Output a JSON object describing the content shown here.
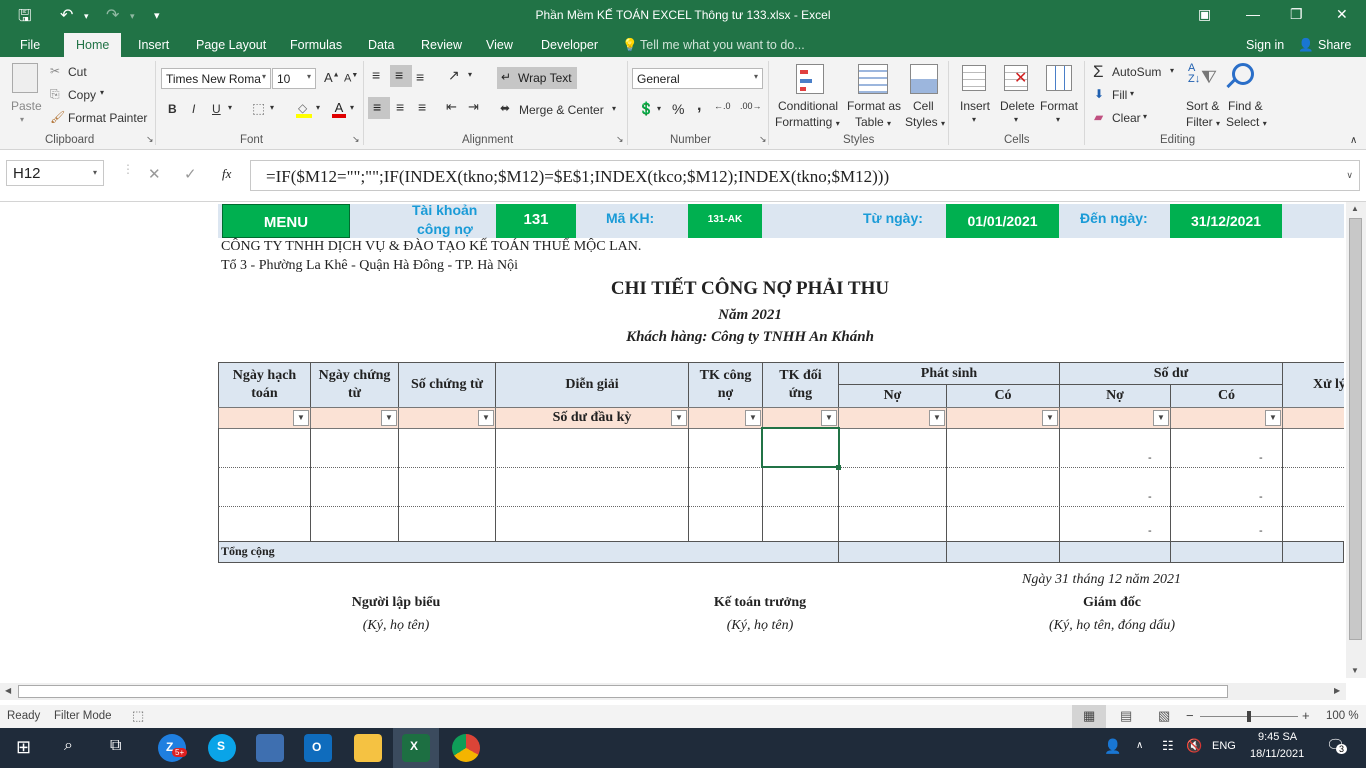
{
  "window": {
    "title": "Phần Mềm KẾ TOÁN  EXCEL Thông tư 133.xlsx - Excel"
  },
  "tabs": [
    "File",
    "Home",
    "Insert",
    "Page Layout",
    "Formulas",
    "Data",
    "Review",
    "View",
    "Developer"
  ],
  "tell_me": "Tell me what you want to do...",
  "sign_in": "Sign in",
  "share": "Share",
  "ribbon": {
    "clipboard": {
      "paste": "Paste",
      "cut": "Cut",
      "copy": "Copy",
      "format_painter": "Format Painter",
      "group": "Clipboard"
    },
    "font": {
      "name": "Times New Roma",
      "size": "10",
      "bold": "B",
      "italic": "I",
      "underline": "U",
      "group": "Font"
    },
    "alignment": {
      "wrap_text": "Wrap Text",
      "merge_center": "Merge & Center",
      "group": "Alignment"
    },
    "number": {
      "format": "General",
      "percent": "%",
      "comma": ",",
      "group": "Number"
    },
    "styles": {
      "conditional": "Conditional",
      "formatting": "Formatting",
      "format_as": "Format as",
      "table": "Table",
      "cell": "Cell",
      "styles_label": "Styles",
      "group": "Styles"
    },
    "cells": {
      "insert": "Insert",
      "delete": "Delete",
      "format": "Format",
      "group": "Cells"
    },
    "editing": {
      "autosum": "AutoSum",
      "fill": "Fill",
      "clear": "Clear",
      "sort": "Sort &",
      "filter": "Filter",
      "find": "Find &",
      "select": "Select",
      "group": "Editing"
    }
  },
  "formula_bar": {
    "name_box": "H12",
    "fx": "fx",
    "formula": "=IF($M12=\"\";\"\";IF(INDEX(tkno;$M12)=$E$1;INDEX(tkco;$M12);INDEX(tkno;$M12)))"
  },
  "sheet": {
    "menu": "MENU",
    "tai_khoan_1": "Tài khoản",
    "tai_khoan_2": "công nợ",
    "tk_value": "131",
    "ma_kh_label": "Mã KH:",
    "ma_kh_value": "131-AK",
    "tu_ngay_label": "Từ ngày:",
    "tu_ngay_value": "01/01/2021",
    "den_ngay_label": "Đến ngày:",
    "den_ngay_value": "31/12/2021",
    "company": "CÔNG TY TNHH DỊCH VỤ & ĐÀO TẠO KẾ TOÁN THUẾ MỘC LAN.",
    "address": "Tổ 3 - Phường La Khê - Quận Hà Đông - TP. Hà Nội",
    "report_title": "CHI TIẾT CÔNG NỢ PHẢI THU",
    "year": "Năm 2021",
    "customer": "Khách hàng: Công ty TNHH An Khánh",
    "headers": {
      "ngay_hach_toan": "Ngày hạch toán",
      "ngay_chung_tu": "Ngày chứng từ",
      "so_chung_tu": "Số chứng từ",
      "dien_giai": "Diễn giải",
      "tk_cong_no": "TK công nợ",
      "tk_doi_ung": "TK đối ứng",
      "phat_sinh": "Phát sinh",
      "so_du": "Số dư",
      "no": "Nợ",
      "co": "Có",
      "xu_ly": "Xử lý"
    },
    "opening_balance": "Số dư đầu kỳ",
    "dash": "-",
    "total": "Tổng cộng",
    "date_line": "Ngày 31 tháng 12 năm 2021",
    "sign1_title": "Người lập biểu",
    "sign1_sub": "(Ký, họ tên)",
    "sign2_title": "Kế toán trưởng",
    "sign2_sub": "(Ký, họ tên)",
    "sign3_title": "Giám đốc",
    "sign3_sub": "(Ký, họ tên, đóng dấu)"
  },
  "status": {
    "ready": "Ready",
    "filter_mode": "Filter Mode",
    "zoom": "100 %"
  },
  "taskbar": {
    "lang": "ENG",
    "time": "9:45 SA",
    "date": "18/11/2021",
    "notif": "3",
    "badge": "5+"
  },
  "colors": {
    "excel_green": "#217346",
    "header_green": "#00b050",
    "light_blue": "#dce6f1",
    "filter_peach": "#fbe2d5"
  }
}
